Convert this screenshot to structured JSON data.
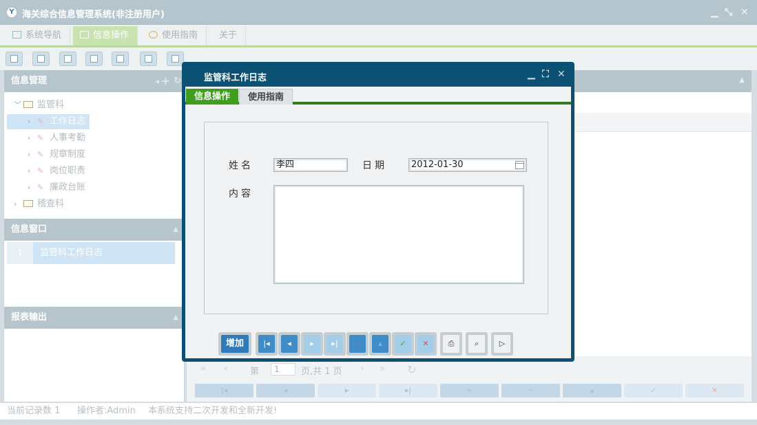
{
  "window": {
    "title": "海关综合信息管理系统(非注册用户)"
  },
  "menu": {
    "tabs": [
      {
        "label": "系统导航"
      },
      {
        "label": "信息操作"
      },
      {
        "label": "使用指南"
      },
      {
        "label": "关于"
      }
    ]
  },
  "left": {
    "info_mgmt_title": "信息管理",
    "tree": {
      "root1": "监管科",
      "children": [
        "工作日志",
        "人事考勤",
        "规章制度",
        "岗位职责",
        "廉政台账"
      ],
      "root2": "稽查科"
    },
    "info_window_title": "信息窗口",
    "info_window_item": {
      "num": "1",
      "label": "监管科工作日志"
    },
    "report_title": "报表输出"
  },
  "pager": {
    "page_prefix": "第",
    "page_value": "1",
    "page_suffix": "页,共 1 页"
  },
  "status": {
    "records": "当前记录数 1",
    "operator": "操作者:Admin",
    "note": "本系统支持二次开发和全新开发!"
  },
  "dialog": {
    "title": "监管科工作日志",
    "tabs": [
      "信息操作",
      "使用指南"
    ],
    "form": {
      "name_label": "姓名",
      "name_value": "李四",
      "date_label": "日期",
      "date_value": "2012-01-30",
      "content_label": "内容"
    },
    "buttons": {
      "add": "增加"
    }
  }
}
